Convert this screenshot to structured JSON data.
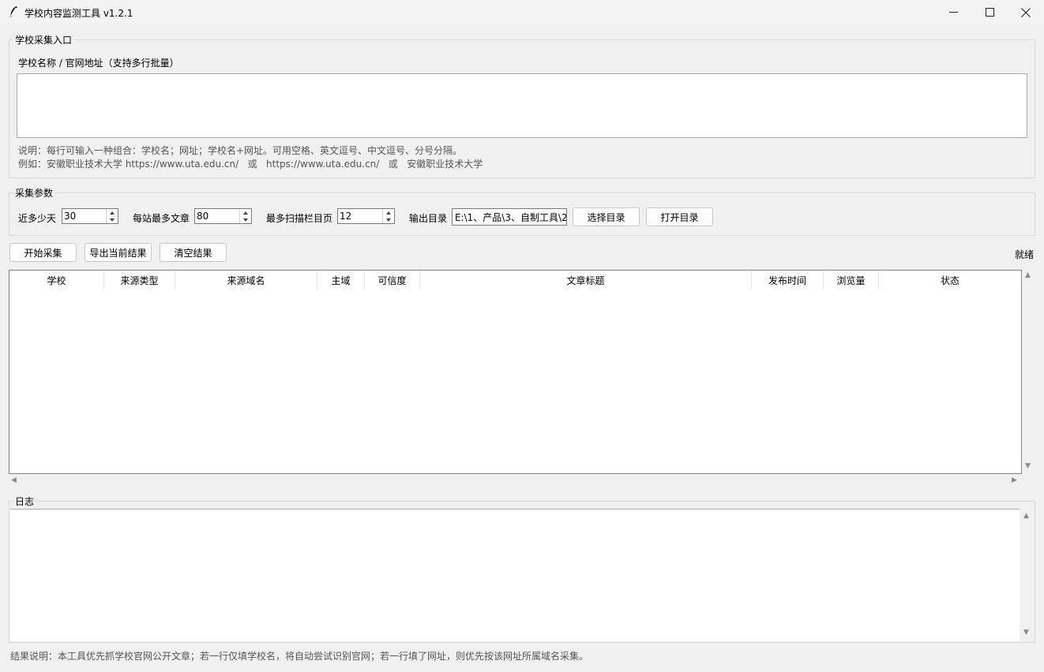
{
  "window": {
    "title": "学校内容监测工具 v1.2.1"
  },
  "input_section": {
    "legend": "学校采集入口",
    "label": "学校名称 / 官网地址（支持多行批量）",
    "textarea_value": "",
    "hint_line1": "说明：每行可输入一种组合：学校名；网址；学校名+网址。可用空格、英文逗号、中文逗号、分号分隔。",
    "hint_line2": "例如：安徽职业技术大学 https://www.uta.edu.cn/   或   https://www.uta.edu.cn/   或   安徽职业技术大学"
  },
  "params": {
    "legend": "采集参数",
    "days_label": "近多少天",
    "days_value": "30",
    "max_articles_label": "每站最多文章",
    "max_articles_value": "80",
    "max_pages_label": "最多扫描栏目页",
    "max_pages_value": "12",
    "output_label": "输出目录",
    "output_value": "E:\\1、产品\\3、自制工具\\2",
    "choose_dir_label": "选择目录",
    "open_dir_label": "打开目录"
  },
  "actions": {
    "start_label": "开始采集",
    "export_label": "导出当前结果",
    "clear_label": "清空结果",
    "status": "就绪"
  },
  "table": {
    "columns": [
      "学校",
      "来源类型",
      "来源域名",
      "主域",
      "可信度",
      "文章标题",
      "发布时间",
      "浏览量",
      "状态"
    ],
    "rows": []
  },
  "log": {
    "legend": "日志",
    "content": ""
  },
  "footer": {
    "note": "结果说明：本工具优先抓学校官网公开文章；若一行仅填学校名，将自动尝试识别官网；若一行填了网址，则优先按该网址所属域名采集。"
  },
  "icons": {
    "app": "feather-icon",
    "minimize": "minimize-icon",
    "maximize": "maximize-icon",
    "close": "close-icon"
  }
}
